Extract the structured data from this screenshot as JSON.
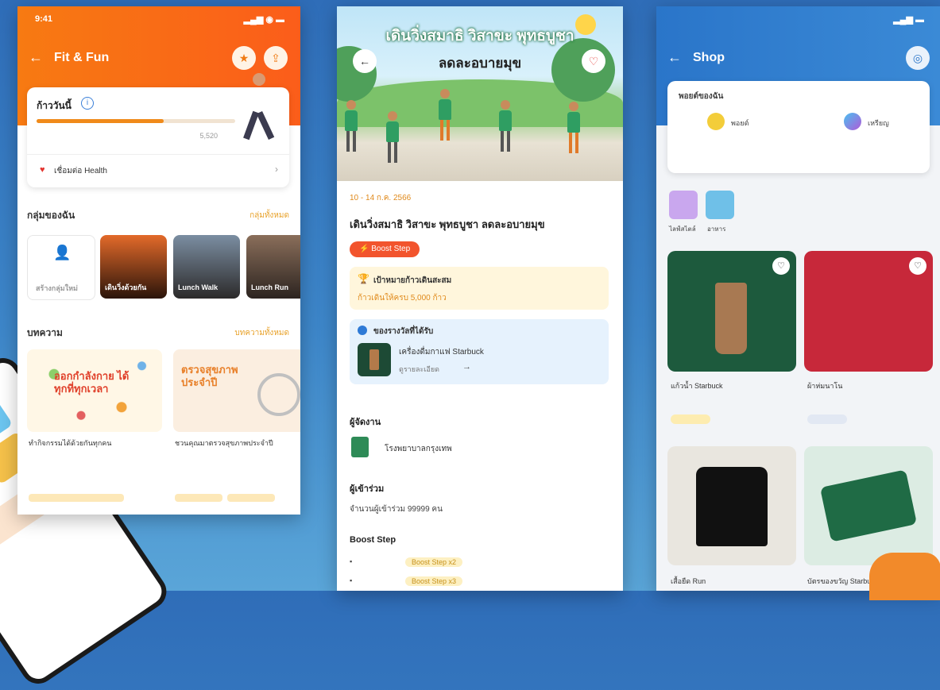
{
  "phone1": {
    "status_time": "9:41",
    "header": {
      "back_icon": "arrow-left-icon",
      "title": "Fit & Fun"
    },
    "steps_card": {
      "label": "ก้าววันนี้",
      "progress": 0.64,
      "value_right": "5,520",
      "health_link": "เชื่อมต่อ Health"
    },
    "groups": {
      "title": "กลุ่มของฉัน",
      "more": "กลุ่มทั้งหมด",
      "items": [
        "สร้างกลุ่มใหม่",
        "เดินวิ่งด้วยกัน",
        "Lunch Walk",
        "Lunch Run"
      ]
    },
    "articles": {
      "title": "บทความ",
      "more": "บทความทั้งหมด",
      "items": [
        {
          "banner": "ออกกำลังกาย ได้ทุกที่ทุกเวลา",
          "caption": "ทำกิจกรรมได้ด้วยกันทุกคน"
        },
        {
          "banner": "ตรวจสุขภาพ ประจำปี",
          "caption": "ชวนคุณมาตรวจสุขภาพประจำปี"
        }
      ]
    }
  },
  "phone2": {
    "banner_title": "เดินวิ่งสมาธิ วิสาขะ พุทธบูชา",
    "banner_subtitle": "ลดละอบายมุข",
    "date": "10 - 14 ก.ค. 2566",
    "event_title": "เดินวิ่งสมาธิ วิสาขะ พุทธบูชา ลดละอบายมุข",
    "badge": "Boost Step",
    "goal_label": "เป้าหมายก้าวเดินสะสม",
    "goal_value": "ก้าวเดินให้ครบ 5,000 ก้าว",
    "reward_label": "ของรางวัลที่ได้รับ",
    "reward_item": "เครื่องดื่มกาแฟ Starbuck",
    "reward_more": "ดูรายละเอียด",
    "organizer_label": "ผู้จัดงาน",
    "organizer": "โรงพยาบาลกรุงเทพ",
    "participants_label": "ผู้เข้าร่วม",
    "participants": "จำนวนผู้เข้าร่วม 99999 คน",
    "boost_label": "Boost Step",
    "boost_rows": [
      "Boost Step x2",
      "Boost Step x3"
    ]
  },
  "phone3": {
    "header": {
      "back_icon": "arrow-left-icon",
      "title": "Shop"
    },
    "points_card": {
      "title": "พอยต์ของฉัน",
      "left_label": "พอยต์",
      "right_label": "เหรียญ"
    },
    "categories": [
      "ไลฟ์สไตล์",
      "อาหาร"
    ],
    "products": [
      {
        "name": "แก้วน้ำ Starbuck",
        "color": "#1d5a3d"
      },
      {
        "name": "ผ้าห่มนาโน",
        "color": "#c7283a"
      },
      {
        "name": "เสื้อยืด Run",
        "color": "#e9e6df"
      },
      {
        "name": "บัตรของขวัญ Starbuck",
        "color": "#dcece3"
      }
    ]
  }
}
